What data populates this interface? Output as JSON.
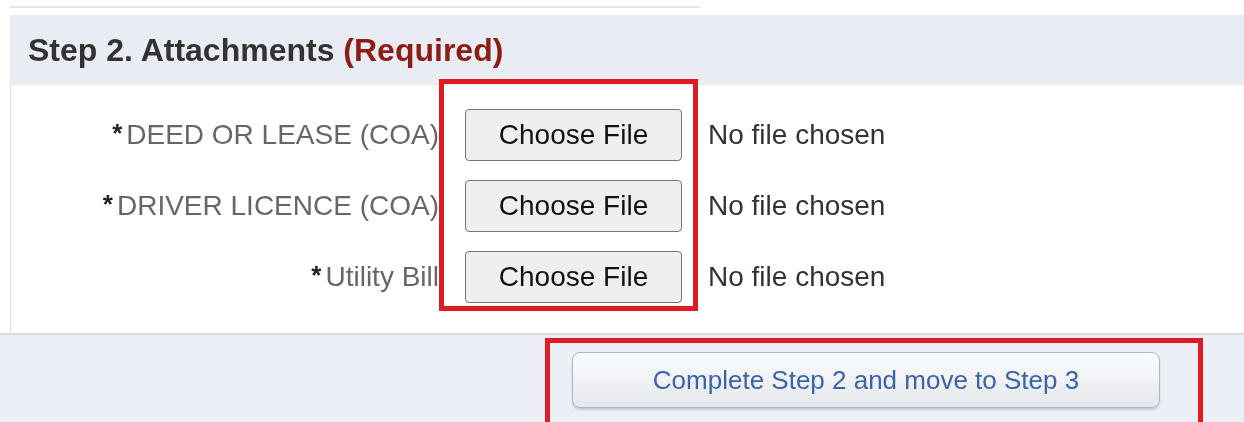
{
  "section": {
    "title": "Step 2. Attachments",
    "note": "(Required)"
  },
  "fields": [
    {
      "marker": "*",
      "label": "DEED OR LEASE (COA)",
      "button": "Choose File",
      "status": "No file chosen"
    },
    {
      "marker": "*",
      "label": "DRIVER LICENCE (COA)",
      "button": "Choose File",
      "status": "No file chosen"
    },
    {
      "marker": "*",
      "label": "Utility Bill",
      "button": "Choose File",
      "status": "No file chosen"
    }
  ],
  "file_buttons_highlighted": true,
  "submit": {
    "label": "Complete Step 2 and move to Step 3",
    "highlighted": true
  }
}
